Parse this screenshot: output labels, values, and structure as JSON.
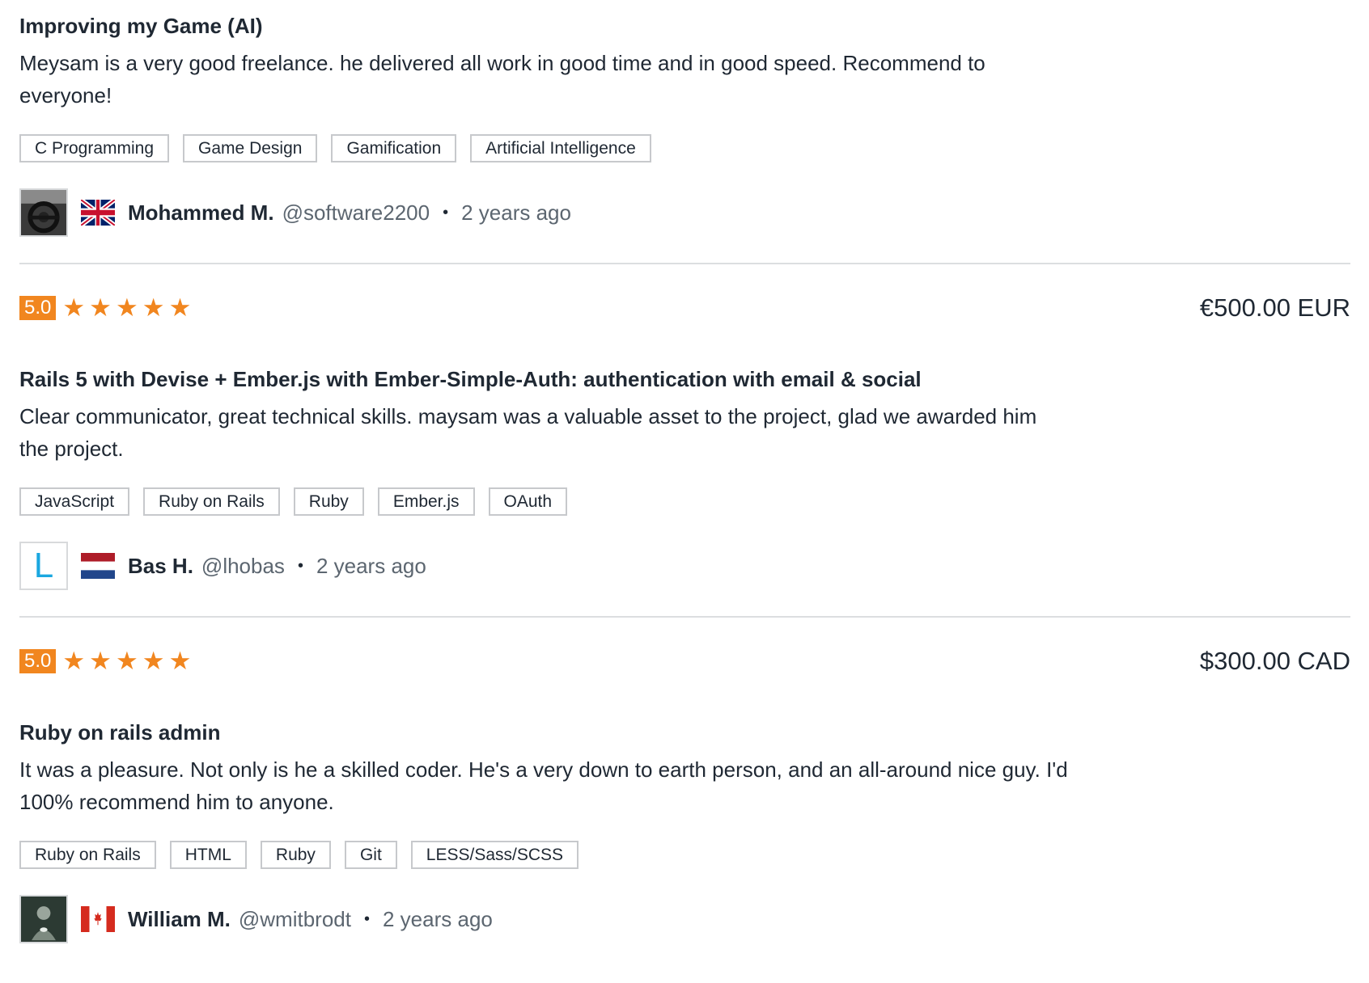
{
  "reviews": [
    {
      "title": "Improving my Game (AI)",
      "comment": "Meysam is a very good freelance. he delivered all work in good time and in good speed. Recommend to everyone!",
      "tags": [
        "C Programming",
        "Game Design",
        "Gamification",
        "Artificial Intelligence"
      ],
      "reviewer": {
        "name": "Mohammed M.",
        "username": "@software2200",
        "separator": "•",
        "time": "2 years ago",
        "country_flag": "uk-flag-icon"
      }
    },
    {
      "score": "5.0",
      "stars": 5,
      "amount": "€500.00 EUR",
      "title": "Rails 5 with Devise + Ember.js with Ember-Simple-Auth: authentication with email & social",
      "comment": "Clear communicator, great technical skills. maysam was a valuable asset to the project, glad we awarded him the project.",
      "tags": [
        "JavaScript",
        "Ruby on Rails",
        "Ruby",
        "Ember.js",
        "OAuth"
      ],
      "reviewer": {
        "avatar_letter": "L",
        "name": "Bas H.",
        "username": "@lhobas",
        "separator": "•",
        "time": "2 years ago",
        "country_flag": "netherlands-flag-icon"
      }
    },
    {
      "score": "5.0",
      "stars": 5,
      "amount": "$300.00 CAD",
      "title": "Ruby on rails admin",
      "comment": "It was a pleasure. Not only is he a skilled coder. He's a very down to earth person, and an all-around nice guy. I'd 100% recommend him to anyone.",
      "tags": [
        "Ruby on Rails",
        "HTML",
        "Ruby",
        "Git",
        "LESS/Sass/SCSS"
      ],
      "reviewer": {
        "name": "William M.",
        "username": "@wmitbrodt",
        "separator": "•",
        "time": "2 years ago",
        "country_flag": "canada-flag-icon"
      }
    }
  ],
  "colors": {
    "accent": "#f1861f",
    "text": "#1f2833",
    "muted": "#5c6670",
    "border": "#c7c9cc"
  }
}
